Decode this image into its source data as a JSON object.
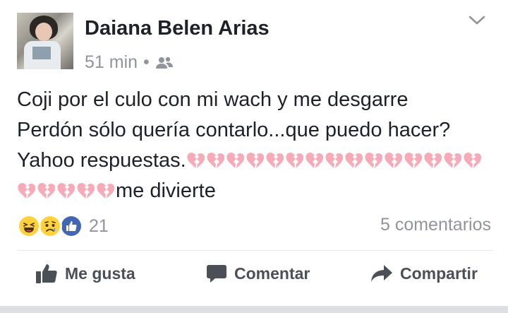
{
  "post": {
    "author": "Daiana Belen Arias",
    "time": "51 min",
    "separator": "•",
    "audience_icon": "friends-icon",
    "menu_icon": "chevron-down-icon",
    "text_lines": [
      "Coji por el culo con mi wach y me desgarre",
      "Perdón sólo quería contarlo...que puedo hacer?",
      "Yahoo respuestas.",
      "me divierte"
    ],
    "emoji": "broken-heart-icon",
    "emoji_count_line3": 15,
    "emoji_count_line4": 5
  },
  "reactions": {
    "icons": [
      "haha-reaction-icon",
      "sad-reaction-icon",
      "like-reaction-icon"
    ],
    "count": "21",
    "comments": "5 comentarios"
  },
  "actions": {
    "like": "Me gusta",
    "comment": "Comentar",
    "share": "Compartir"
  },
  "colors": {
    "text": "#1d2129",
    "muted": "#90949c",
    "action": "#4b4f56",
    "heart": "#f7aab8",
    "like_blue": "#4267b2",
    "emoji_yellow": "#ffd13d"
  }
}
